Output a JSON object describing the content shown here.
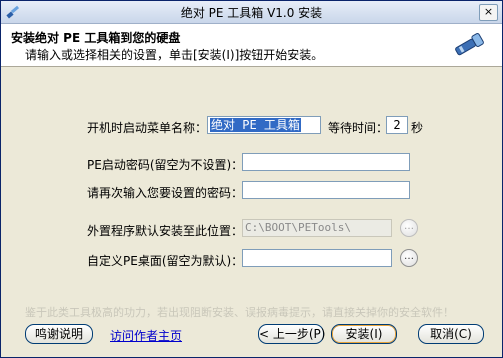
{
  "window": {
    "title": "绝对 PE 工具箱 V1.0 安装",
    "close_label": "×"
  },
  "header": {
    "title": "安装绝对 PE 工具箱到您的硬盘",
    "subtitle": "请输入或选择相关的设置，单击[安装(I)]按钮开始安装。"
  },
  "form": {
    "menu_name_label": "开机时启动菜单名称：",
    "menu_name_value": "绝对 PE 工具箱",
    "wait_label": "等待时间：",
    "wait_value": "2",
    "wait_unit": "秒",
    "pe_password_label": "PE启动密码(留空为不设置)：",
    "pe_password_value": "",
    "confirm_password_label": "请再次输入您要设置的密码：",
    "confirm_password_value": "",
    "external_path_label": "外置程序默认安装至此位置：",
    "external_path_value": "C:\\BOOT\\PETools\\",
    "desktop_label": "自定义PE桌面(留空为默认)：",
    "desktop_value": "",
    "browse_label": "…"
  },
  "notice": "鉴于此类工具极高的功力，若出现阻断安装、误报病毒提示，请直接关掉你的安全软件！",
  "footer": {
    "thanks_label": "鸣谢说明",
    "visit_author_label": "访问作者主页",
    "back_label": "< 上一步(P)",
    "install_label": "安装(I)",
    "cancel_label": "取消(C)"
  }
}
